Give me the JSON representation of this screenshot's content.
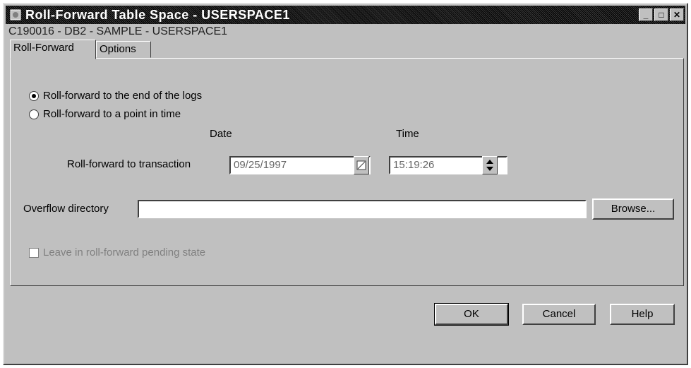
{
  "window": {
    "title": "Roll-Forward Table Space - USERSPACE1",
    "subtitle": "C190016 - DB2 - SAMPLE - USERSPACE1"
  },
  "tabs": [
    {
      "label": "Roll-Forward",
      "active": true
    },
    {
      "label": "Options",
      "active": false
    }
  ],
  "roll_forward": {
    "option_end_of_logs": "Roll-forward to the end of the logs",
    "option_point_in_time": "Roll-forward to a point in time",
    "selected": "end_of_logs",
    "date_header": "Date",
    "time_header": "Time",
    "transaction_label": "Roll-forward to transaction",
    "date_value": "09/25/1997",
    "time_value": "15:19:26",
    "overflow_label": "Overflow directory",
    "overflow_value": "",
    "browse_label": "Browse...",
    "leave_pending_label": "Leave in roll-forward pending state",
    "leave_pending_checked": false
  },
  "buttons": {
    "ok": "OK",
    "cancel": "Cancel",
    "help": "Help"
  }
}
